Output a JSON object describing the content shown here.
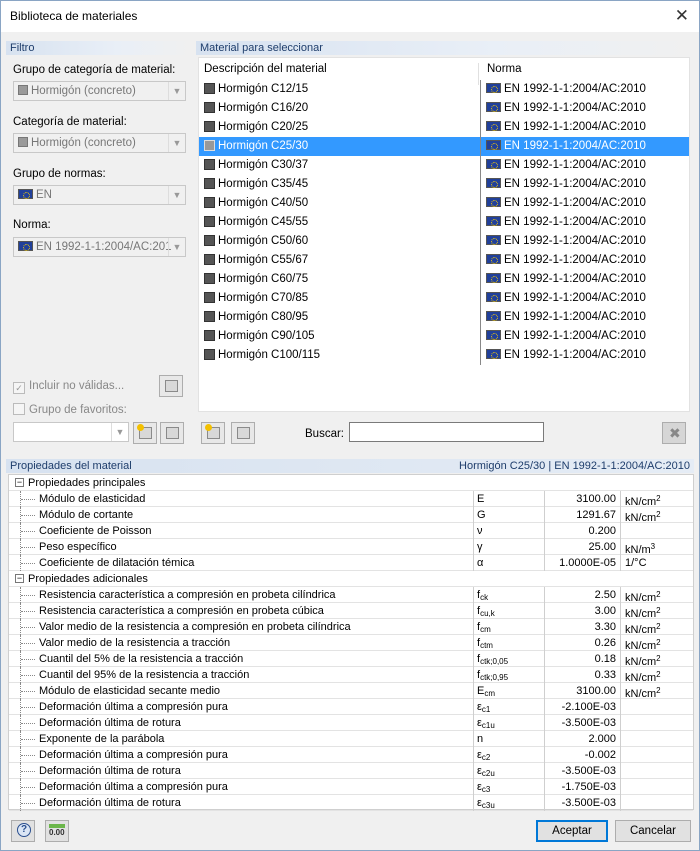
{
  "window": {
    "title": "Biblioteca de materiales",
    "close": "✕"
  },
  "filter": {
    "header": "Filtro",
    "group_label": "Grupo de categoría de material:",
    "group_value": "Hormigón (concreto)",
    "category_label": "Categoría de material:",
    "category_value": "Hormigón (concreto)",
    "norm_group_label": "Grupo de normas:",
    "norm_group_value": "EN",
    "norm_label": "Norma:",
    "norm_value": "EN 1992-1-1:2004/AC:201",
    "include_invalid": "Incluir no válidas...",
    "favorites": "Grupo de favoritos:"
  },
  "materials": {
    "header": "Material para seleccionar",
    "col_desc": "Descripción del material",
    "col_norm": "Norma",
    "selected_index": 3,
    "rows": [
      {
        "name": "Hormigón C12/15",
        "norm": "EN 1992-1-1:2004/AC:2010"
      },
      {
        "name": "Hormigón C16/20",
        "norm": "EN 1992-1-1:2004/AC:2010"
      },
      {
        "name": "Hormigón C20/25",
        "norm": "EN 1992-1-1:2004/AC:2010"
      },
      {
        "name": "Hormigón C25/30",
        "norm": "EN 1992-1-1:2004/AC:2010"
      },
      {
        "name": "Hormigón C30/37",
        "norm": "EN 1992-1-1:2004/AC:2010"
      },
      {
        "name": "Hormigón C35/45",
        "norm": "EN 1992-1-1:2004/AC:2010"
      },
      {
        "name": "Hormigón C40/50",
        "norm": "EN 1992-1-1:2004/AC:2010"
      },
      {
        "name": "Hormigón C45/55",
        "norm": "EN 1992-1-1:2004/AC:2010"
      },
      {
        "name": "Hormigón C50/60",
        "norm": "EN 1992-1-1:2004/AC:2010"
      },
      {
        "name": "Hormigón C55/67",
        "norm": "EN 1992-1-1:2004/AC:2010"
      },
      {
        "name": "Hormigón C60/75",
        "norm": "EN 1992-1-1:2004/AC:2010"
      },
      {
        "name": "Hormigón C70/85",
        "norm": "EN 1992-1-1:2004/AC:2010"
      },
      {
        "name": "Hormigón C80/95",
        "norm": "EN 1992-1-1:2004/AC:2010"
      },
      {
        "name": "Hormigón C90/105",
        "norm": "EN 1992-1-1:2004/AC:2010"
      },
      {
        "name": "Hormigón C100/115",
        "norm": "EN 1992-1-1:2004/AC:2010"
      }
    ],
    "search_label": "Buscar:",
    "search_value": ""
  },
  "properties": {
    "header": "Propiedades del material",
    "header_right": "Hormigón C25/30  |  EN 1992-1-1:2004/AC:2010",
    "main_group": "Propiedades principales",
    "main": [
      {
        "name": "Módulo de elasticidad",
        "sym": "E",
        "sub": "",
        "val": "3100.00",
        "unit": "kN/cm",
        "sup": "2"
      },
      {
        "name": "Módulo de cortante",
        "sym": "G",
        "sub": "",
        "val": "1291.67",
        "unit": "kN/cm",
        "sup": "2"
      },
      {
        "name": "Coeficiente de Poisson",
        "sym": "ν",
        "sub": "",
        "val": "0.200",
        "unit": "",
        "sup": ""
      },
      {
        "name": "Peso específico",
        "sym": "γ",
        "sub": "",
        "val": "25.00",
        "unit": "kN/m",
        "sup": "3"
      },
      {
        "name": "Coeficiente de dilatación témica",
        "sym": "α",
        "sub": "",
        "val": "1.0000E-05",
        "unit": "1/°C",
        "sup": ""
      }
    ],
    "extra_group": "Propiedades adicionales",
    "extra": [
      {
        "name": "Resistencia característica a compresión en probeta cilíndrica",
        "sym": "f",
        "sub": "ck",
        "val": "2.50",
        "unit": "kN/cm",
        "sup": "2"
      },
      {
        "name": "Resistencia característica a compresión en probeta cúbica",
        "sym": "f",
        "sub": "cu,k",
        "val": "3.00",
        "unit": "kN/cm",
        "sup": "2"
      },
      {
        "name": "Valor medio de la resistencia a compresión en probeta cilíndrica",
        "sym": "f",
        "sub": "cm",
        "val": "3.30",
        "unit": "kN/cm",
        "sup": "2"
      },
      {
        "name": "Valor medio de la resistencia a tracción",
        "sym": "f",
        "sub": "ctm",
        "val": "0.26",
        "unit": "kN/cm",
        "sup": "2"
      },
      {
        "name": "Cuantil del 5% de la resistencia a tracción",
        "sym": "f",
        "sub": "ctk;0,05",
        "val": "0.18",
        "unit": "kN/cm",
        "sup": "2"
      },
      {
        "name": "Cuantil del 95% de la resistencia a tracción",
        "sym": "f",
        "sub": "ctk;0,95",
        "val": "0.33",
        "unit": "kN/cm",
        "sup": "2"
      },
      {
        "name": "Módulo de elasticidad secante medio",
        "sym": "E",
        "sub": "cm",
        "val": "3100.00",
        "unit": "kN/cm",
        "sup": "2"
      },
      {
        "name": "Deformación última a compresión pura",
        "sym": "ε",
        "sub": "c1",
        "val": "-2.100E-03",
        "unit": "",
        "sup": ""
      },
      {
        "name": "Deformación última de rotura",
        "sym": "ε",
        "sub": "c1u",
        "val": "-3.500E-03",
        "unit": "",
        "sup": ""
      },
      {
        "name": "Exponente de la parábola",
        "sym": "n",
        "sub": "",
        "val": "2.000",
        "unit": "",
        "sup": ""
      },
      {
        "name": "Deformación última a compresión pura",
        "sym": "ε",
        "sub": "c2",
        "val": "-0.002",
        "unit": "",
        "sup": ""
      },
      {
        "name": "Deformación última de rotura",
        "sym": "ε",
        "sub": "c2u",
        "val": "-3.500E-03",
        "unit": "",
        "sup": ""
      },
      {
        "name": "Deformación última a compresión pura",
        "sym": "ε",
        "sub": "c3",
        "val": "-1.750E-03",
        "unit": "",
        "sup": ""
      },
      {
        "name": "Deformación última de rotura",
        "sym": "ε",
        "sub": "c3u",
        "val": "-3.500E-03",
        "unit": "",
        "sup": ""
      }
    ]
  },
  "footer": {
    "accept": "Aceptar",
    "cancel": "Cancelar",
    "units_icon_text": "0.00",
    "help_icon_text": "?"
  }
}
